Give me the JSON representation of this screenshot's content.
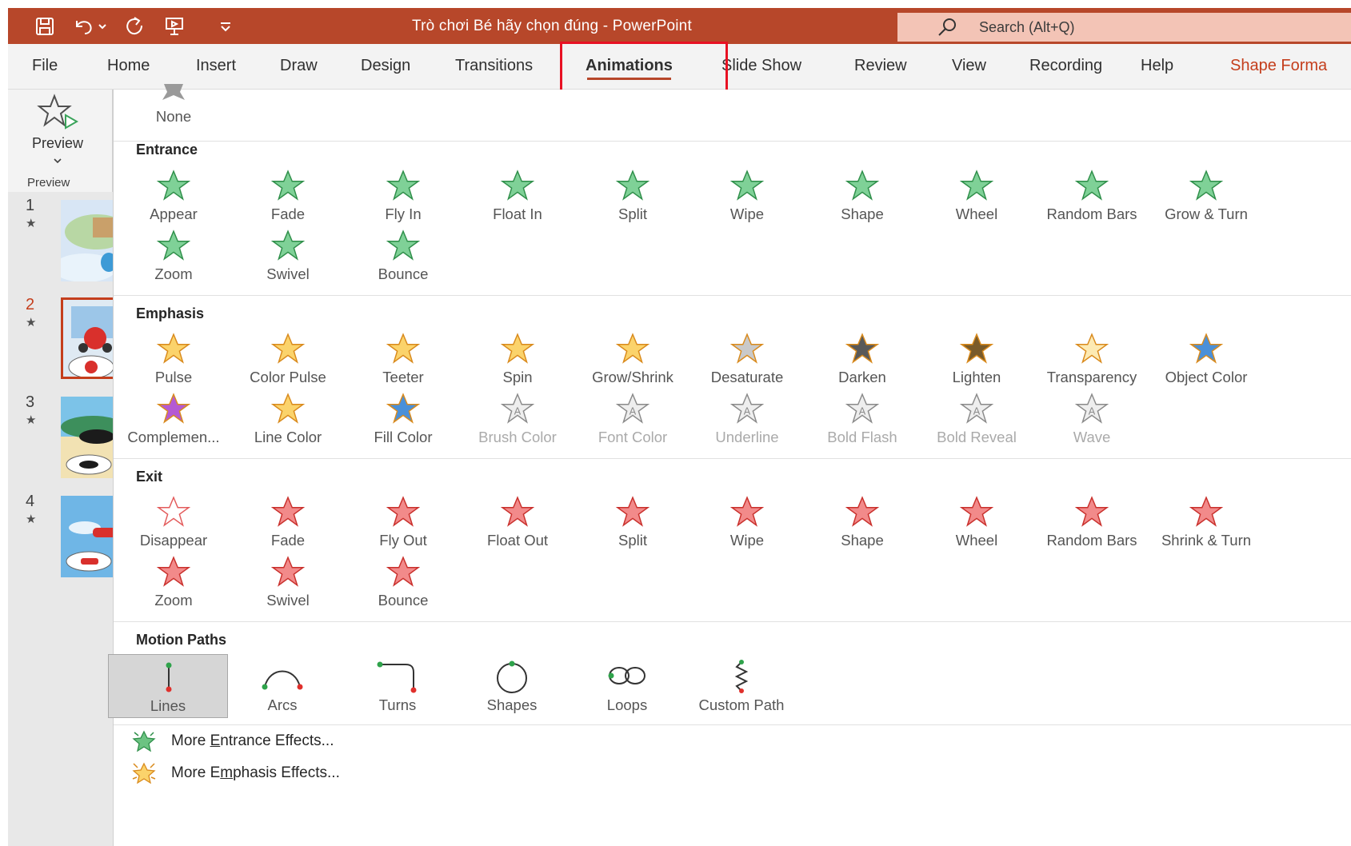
{
  "app": {
    "title": "Trò chơi Bé hãy chọn đúng  -  PowerPoint",
    "search_placeholder": "Search (Alt+Q)",
    "accent_color": "#b7472a"
  },
  "quick_access": [
    "save-icon",
    "undo-icon",
    "undo-dropdown-icon",
    "redo-icon",
    "present-icon",
    "customize-icon"
  ],
  "tabs": [
    {
      "label": "File"
    },
    {
      "label": "Home"
    },
    {
      "label": "Insert"
    },
    {
      "label": "Draw"
    },
    {
      "label": "Design"
    },
    {
      "label": "Transitions"
    },
    {
      "label": "Animations",
      "active": true
    },
    {
      "label": "Slide Show"
    },
    {
      "label": "Review"
    },
    {
      "label": "View"
    },
    {
      "label": "Recording"
    },
    {
      "label": "Help"
    },
    {
      "label": "Shape Forma"
    }
  ],
  "preview": {
    "button_label": "Preview",
    "group_label": "Preview"
  },
  "slides": [
    {
      "num": "1",
      "star": "★"
    },
    {
      "num": "2",
      "star": "★",
      "selected": true
    },
    {
      "num": "3",
      "star": "★"
    },
    {
      "num": "4",
      "star": "★"
    }
  ],
  "none_label": "None",
  "sections": {
    "entrance": {
      "title": "Entrance",
      "items": [
        "Appear",
        "Fade",
        "Fly In",
        "Float In",
        "Split",
        "Wipe",
        "Shape",
        "Wheel",
        "Random Bars",
        "Grow & Turn",
        "Zoom",
        "Swivel",
        "Bounce"
      ]
    },
    "emphasis": {
      "title": "Emphasis",
      "items": [
        "Pulse",
        "Color Pulse",
        "Teeter",
        "Spin",
        "Grow/Shrink",
        "Desaturate",
        "Darken",
        "Lighten",
        "Transparency",
        "Object Color",
        "Complemen...",
        "Line Color",
        "Fill Color",
        "Brush Color",
        "Font Color",
        "Underline",
        "Bold Flash",
        "Bold Reveal",
        "Wave"
      ]
    },
    "exit": {
      "title": "Exit",
      "items": [
        "Disappear",
        "Fade",
        "Fly Out",
        "Float Out",
        "Split",
        "Wipe",
        "Shape",
        "Wheel",
        "Random Bars",
        "Shrink & Turn",
        "Zoom",
        "Swivel",
        "Bounce"
      ]
    },
    "motion": {
      "title": "Motion Paths",
      "items": [
        "Lines",
        "Arcs",
        "Turns",
        "Shapes",
        "Loops",
        "Custom Path"
      ]
    }
  },
  "more": {
    "entrance_pre": "More ",
    "entrance_u": "E",
    "entrance_post": "ntrance Effects...",
    "emphasis_pre": "More E",
    "emphasis_u": "m",
    "emphasis_post": "phasis Effects..."
  }
}
